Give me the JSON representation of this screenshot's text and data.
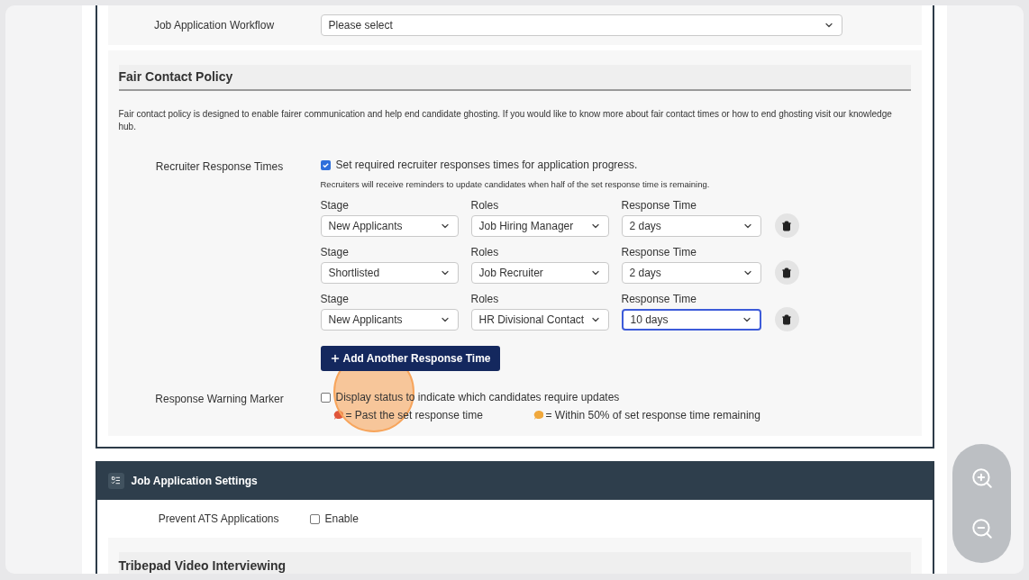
{
  "workflow": {
    "label": "Job Application Workflow",
    "value": "Please select"
  },
  "fair_contact": {
    "title": "Fair Contact Policy",
    "description": "Fair contact policy is designed to enable fairer communication and help end candidate ghosting. If you would like to know more about fair contact times or how to end ghosting visit our knowledge hub.",
    "response_times": {
      "label": "Recruiter Response Times",
      "checkbox": {
        "label": "Set required recruiter responses times for application progress.",
        "checked": true
      },
      "note": "Recruiters will receive reminders to update candidates when half of the set response time is remaining.",
      "rows": [
        {
          "stage_label": "Stage",
          "stage": "New Applicants",
          "roles_label": "Roles",
          "role": "Job Hiring Manager",
          "time_label": "Response Time",
          "time": "2 days",
          "focused": false
        },
        {
          "stage_label": "Stage",
          "stage": "Shortlisted",
          "roles_label": "Roles",
          "role": "Job Recruiter",
          "time_label": "Response Time",
          "time": "2 days",
          "focused": false
        },
        {
          "stage_label": "Stage",
          "stage": "New Applicants",
          "roles_label": "Roles",
          "role": "HR Divisional Contact",
          "time_label": "Response Time",
          "time": "10 days",
          "focused": true
        }
      ],
      "add_button": "Add Another Response Time"
    },
    "warning_marker": {
      "label": "Response Warning Marker",
      "checkbox": {
        "label": "Display status to indicate which candidates require updates",
        "checked": false
      },
      "legend": [
        {
          "text": "= Past the set response time",
          "color": "#e0553a"
        },
        {
          "text": "= Within 50% of set response time remaining",
          "color": "#f0a83c"
        }
      ]
    }
  },
  "job_application_settings": {
    "title": "Job Application Settings",
    "prevent_ats": {
      "label": "Prevent ATS Applications",
      "checkbox": {
        "label": "Enable",
        "checked": false
      }
    }
  },
  "video_interviewing": {
    "title": "Tribepad Video Interviewing"
  }
}
